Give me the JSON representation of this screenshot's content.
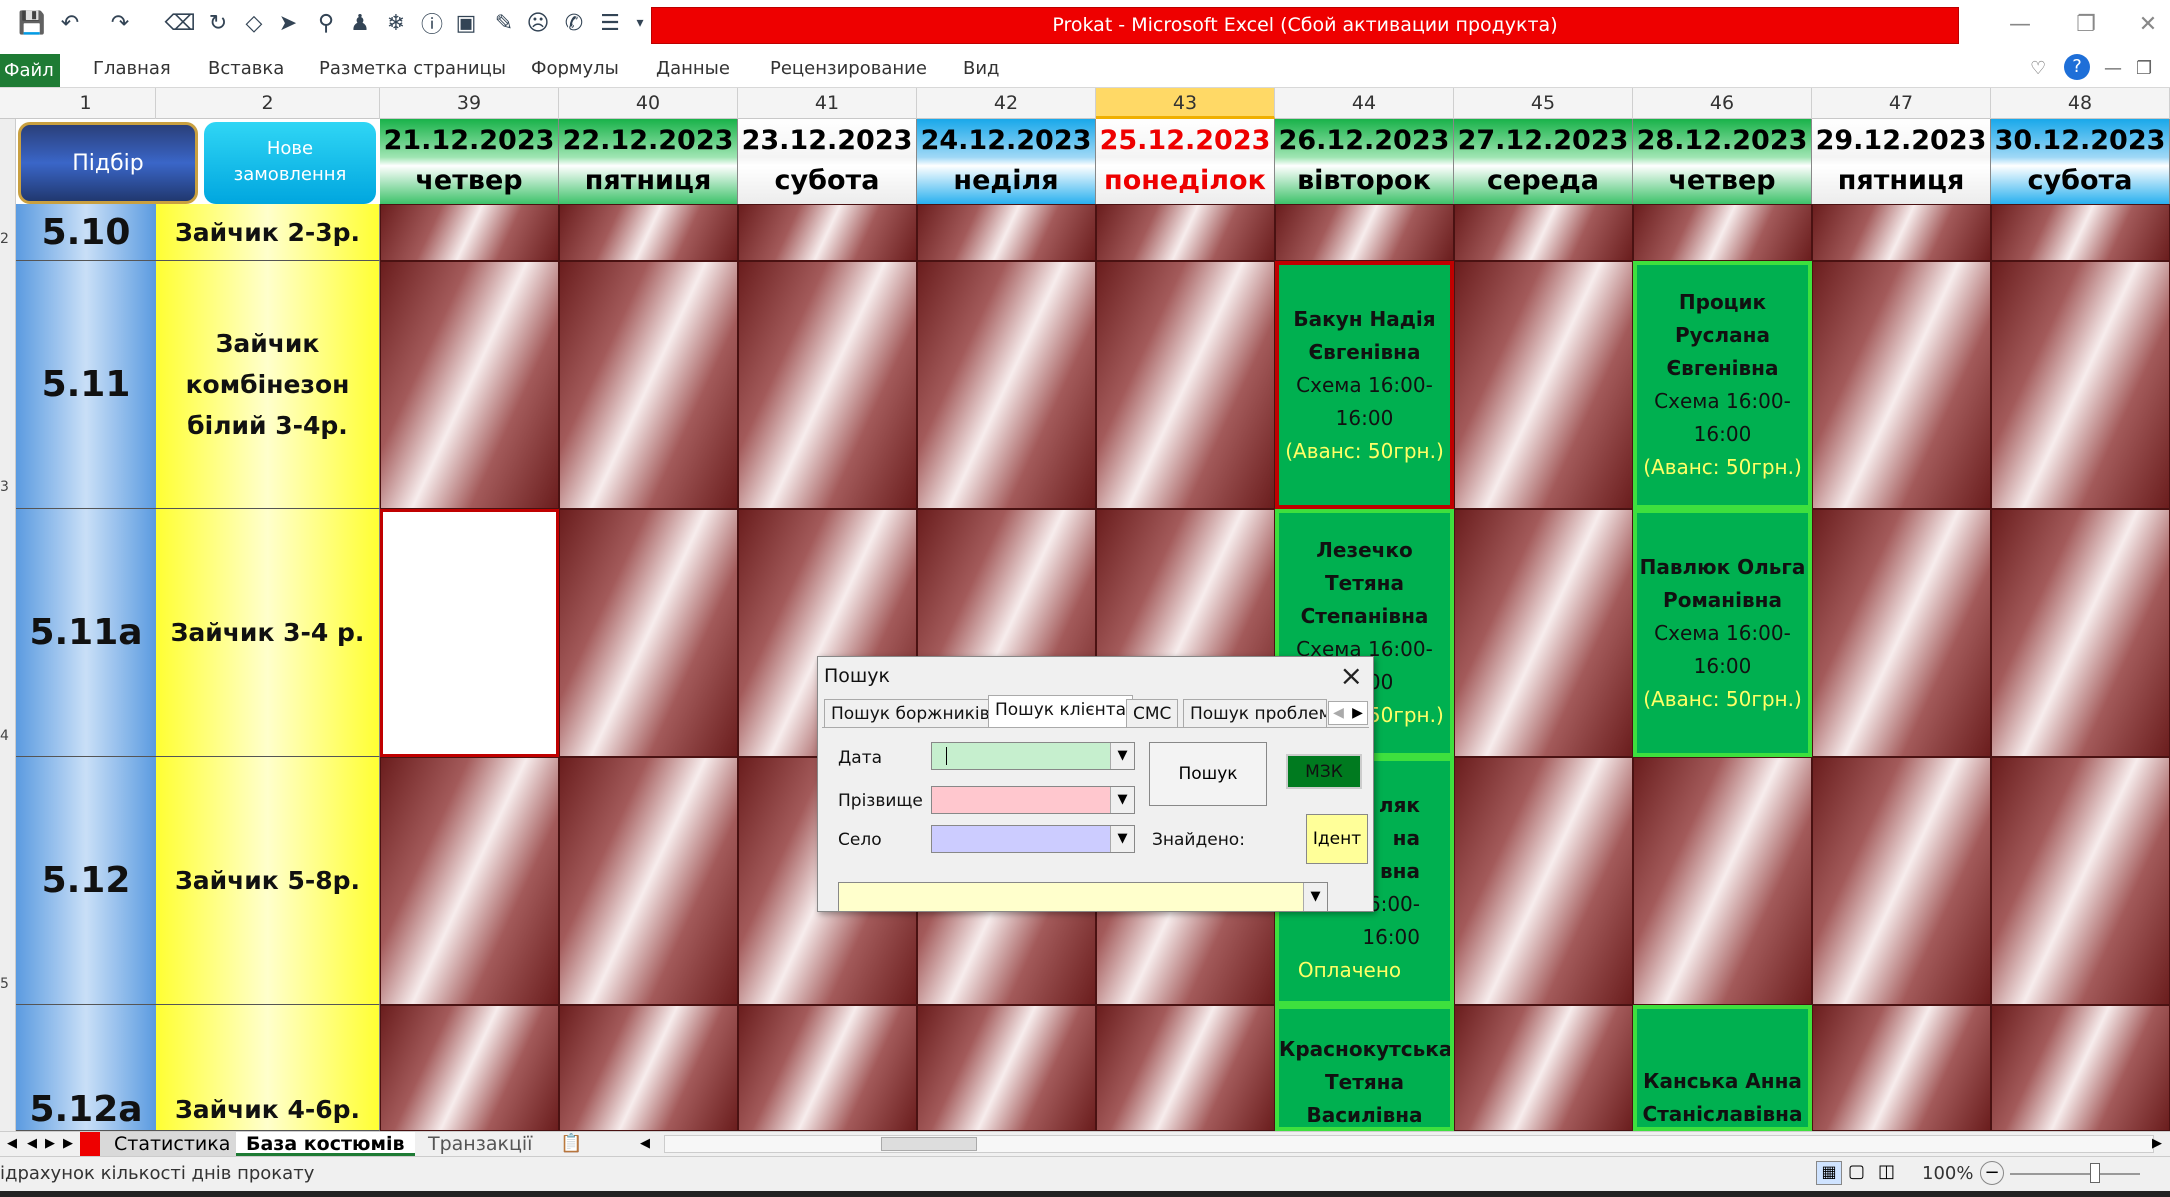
{
  "window": {
    "title": "Prokat  -  Microsoft Excel (Сбой активации продукта)"
  },
  "ribbon": {
    "file": "Файл",
    "tabs": [
      "Главная",
      "Вставка",
      "Разметка страницы",
      "Формулы",
      "Данные",
      "Рецензирование",
      "Вид"
    ]
  },
  "columns": [
    "1",
    "2",
    "39",
    "40",
    "41",
    "42",
    "43",
    "44",
    "45",
    "46",
    "47",
    "48"
  ],
  "rows": [
    "2",
    "3",
    "4",
    "5"
  ],
  "header_buttons": {
    "pick": "Підбір",
    "new_order": "Нове замовлення"
  },
  "dates": [
    {
      "date": "21.12.2023",
      "day": "четвер"
    },
    {
      "date": "22.12.2023",
      "day": "пятниця"
    },
    {
      "date": "23.12.2023",
      "day": "субота"
    },
    {
      "date": "24.12.2023",
      "day": "неділя"
    },
    {
      "date": "25.12.2023",
      "day": "понеділок"
    },
    {
      "date": "26.12.2023",
      "day": "вівторок"
    },
    {
      "date": "27.12.2023",
      "day": "середа"
    },
    {
      "date": "28.12.2023",
      "day": "четвер"
    },
    {
      "date": "29.12.2023",
      "day": "пятниця"
    },
    {
      "date": "30.12.2023",
      "day": "субота"
    }
  ],
  "costumes": [
    {
      "code": "5.10",
      "name": "Зайчик 2-3р."
    },
    {
      "code": "5.11",
      "name": "Зайчик комбінезон білий 3-4р."
    },
    {
      "code": "5.11а",
      "name": "Зайчик 3-4 р."
    },
    {
      "code": "5.12",
      "name": "Зайчик 5-8р."
    },
    {
      "code": "5.12а",
      "name": "Зайчик 4-6р."
    }
  ],
  "bookings": {
    "b1": {
      "name": "Бакун Надія Євгенівна",
      "scheme": "Схема 16:00-16:00",
      "note": "(Аванс: 50грн.)"
    },
    "b2": {
      "name": "Процик Руслана Євгенівна",
      "scheme": "Схема 16:00-16:00",
      "note": "(Аванс: 50грн.)"
    },
    "b3": {
      "name": "Лезечко Тетяна Степанівна",
      "scheme": "Схема 16:00-16:00",
      "note": "(Аванс: 50грн.)"
    },
    "b4": {
      "name": "Павлюк Ольга Романівна",
      "scheme": "Схема 16:00-16:00",
      "note": "(Аванс: 50грн.)"
    },
    "b5": {
      "l1": "ляк",
      "l2": "на",
      "l3": "вна",
      "l4": "16:00-",
      "l5": "16:00",
      "note": "Оплачено"
    },
    "b6": {
      "name": "Краснокутська Тетяна Василівна"
    },
    "b7": {
      "name": "Канська Анна Станіславівна"
    }
  },
  "dialog": {
    "title": "Пошук",
    "tabs": [
      "Пошук боржників",
      "Пошук клієнта",
      "СМС",
      "Пошук проблем"
    ],
    "labels": {
      "date": "Дата",
      "surname": "Прізвище",
      "village": "Село",
      "found": "Знайдено:"
    },
    "buttons": {
      "search": "Пошук",
      "mzk": "МЗК",
      "ident": "Ідент"
    },
    "colors": {
      "date": "#c6efce",
      "surname": "#ffc7ce",
      "village": "#ccccff",
      "result": "#ffffcc"
    }
  },
  "sheets": [
    "Статистика",
    "База костюмів",
    "Транзакції"
  ],
  "status": {
    "text": "ідрахунок кількості днів прокату",
    "zoom": "100%"
  }
}
